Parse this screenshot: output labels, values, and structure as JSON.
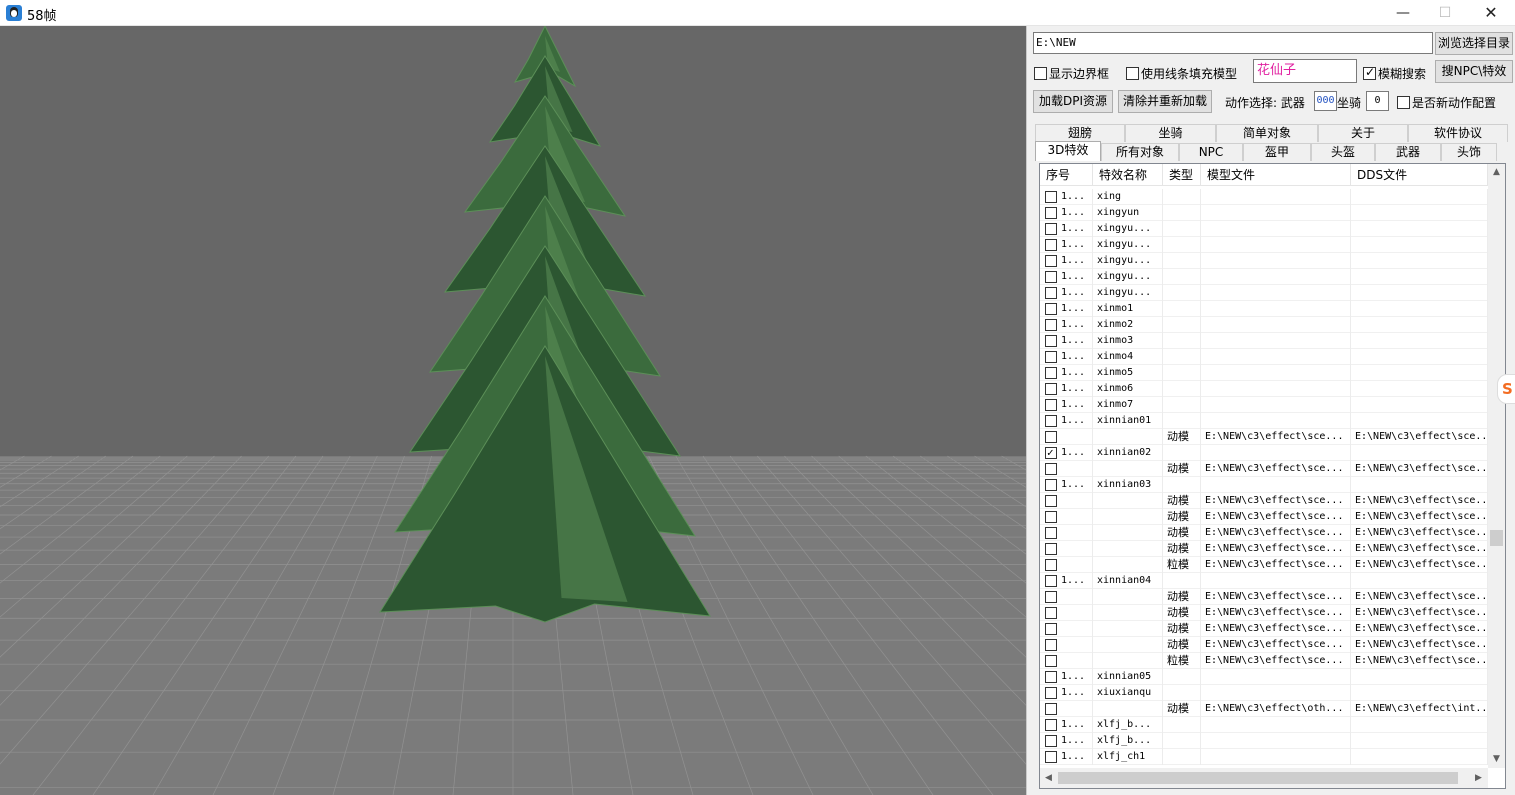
{
  "window": {
    "title": "58帧",
    "minimize_glyph": "—",
    "maximize_glyph": "☐",
    "close_glyph": "✕",
    "icon": "penguin-icon"
  },
  "toolbar": {
    "path_value": "E:\\NEW",
    "browse_label": "浏览选择目录",
    "show_border_label": "显示边界框",
    "show_border_checked": false,
    "line_fill_label": "使用线条填充模型",
    "line_fill_checked": false,
    "search_value": "花仙子",
    "search_color": "#e020a0",
    "fuzzy_label": "模糊搜索",
    "fuzzy_checked": true,
    "search_npc_label": "搜NPC\\特效",
    "load_dpi_label": "加载DPI资源",
    "clear_reload_label": "清除并重新加载",
    "action_label": "动作选择: 武器",
    "weapon_value": "000",
    "mount_label": "坐骑",
    "mount_value": "0",
    "new_action_label": "是否新动作配置",
    "new_action_checked": false
  },
  "tabs": {
    "row1": [
      "翅膀",
      "坐骑",
      "简单对象",
      "关于",
      "软件协议"
    ],
    "row2": [
      "3D特效",
      "所有对象",
      "NPC",
      "盔甲",
      "头盔",
      "武器",
      "头饰"
    ],
    "active": "3D特效"
  },
  "list": {
    "columns": [
      "序号",
      "特效名称",
      "类型",
      "模型文件",
      "DDS文件"
    ],
    "rows": [
      {
        "idx": "1...",
        "name": "xing",
        "type": "",
        "model": "",
        "dds": "",
        "checked": false
      },
      {
        "idx": "1...",
        "name": "xingyun",
        "type": "",
        "model": "",
        "dds": "",
        "checked": false
      },
      {
        "idx": "1...",
        "name": "xingyu...",
        "type": "",
        "model": "",
        "dds": "",
        "checked": false
      },
      {
        "idx": "1...",
        "name": "xingyu...",
        "type": "",
        "model": "",
        "dds": "",
        "checked": false
      },
      {
        "idx": "1...",
        "name": "xingyu...",
        "type": "",
        "model": "",
        "dds": "",
        "checked": false
      },
      {
        "idx": "1...",
        "name": "xingyu...",
        "type": "",
        "model": "",
        "dds": "",
        "checked": false
      },
      {
        "idx": "1...",
        "name": "xingyu...",
        "type": "",
        "model": "",
        "dds": "",
        "checked": false
      },
      {
        "idx": "1...",
        "name": "xinmo1",
        "type": "",
        "model": "",
        "dds": "",
        "checked": false
      },
      {
        "idx": "1...",
        "name": "xinmo2",
        "type": "",
        "model": "",
        "dds": "",
        "checked": false
      },
      {
        "idx": "1...",
        "name": "xinmo3",
        "type": "",
        "model": "",
        "dds": "",
        "checked": false
      },
      {
        "idx": "1...",
        "name": "xinmo4",
        "type": "",
        "model": "",
        "dds": "",
        "checked": false
      },
      {
        "idx": "1...",
        "name": "xinmo5",
        "type": "",
        "model": "",
        "dds": "",
        "checked": false
      },
      {
        "idx": "1...",
        "name": "xinmo6",
        "type": "",
        "model": "",
        "dds": "",
        "checked": false
      },
      {
        "idx": "1...",
        "name": "xinmo7",
        "type": "",
        "model": "",
        "dds": "",
        "checked": false
      },
      {
        "idx": "1...",
        "name": "xinnian01",
        "type": "",
        "model": "",
        "dds": "",
        "checked": false
      },
      {
        "idx": "",
        "name": "",
        "type": "动模",
        "model": "E:\\NEW\\c3\\effect\\sce...",
        "dds": "E:\\NEW\\c3\\effect\\sce...",
        "checked": false
      },
      {
        "idx": "1...",
        "name": "xinnian02",
        "type": "",
        "model": "",
        "dds": "",
        "checked": true
      },
      {
        "idx": "",
        "name": "",
        "type": "动模",
        "model": "E:\\NEW\\c3\\effect\\sce...",
        "dds": "E:\\NEW\\c3\\effect\\sce...",
        "checked": false
      },
      {
        "idx": "1...",
        "name": "xinnian03",
        "type": "",
        "model": "",
        "dds": "",
        "checked": false
      },
      {
        "idx": "",
        "name": "",
        "type": "动模",
        "model": "E:\\NEW\\c3\\effect\\sce...",
        "dds": "E:\\NEW\\c3\\effect\\sce...",
        "checked": false
      },
      {
        "idx": "",
        "name": "",
        "type": "动模",
        "model": "E:\\NEW\\c3\\effect\\sce...",
        "dds": "E:\\NEW\\c3\\effect\\sce...",
        "checked": false
      },
      {
        "idx": "",
        "name": "",
        "type": "动模",
        "model": "E:\\NEW\\c3\\effect\\sce...",
        "dds": "E:\\NEW\\c3\\effect\\sce...",
        "checked": false
      },
      {
        "idx": "",
        "name": "",
        "type": "动模",
        "model": "E:\\NEW\\c3\\effect\\sce...",
        "dds": "E:\\NEW\\c3\\effect\\sce...",
        "checked": false
      },
      {
        "idx": "",
        "name": "",
        "type": "粒模",
        "model": "E:\\NEW\\c3\\effect\\sce...",
        "dds": "E:\\NEW\\c3\\effect\\sce...",
        "checked": false
      },
      {
        "idx": "1...",
        "name": "xinnian04",
        "type": "",
        "model": "",
        "dds": "",
        "checked": false
      },
      {
        "idx": "",
        "name": "",
        "type": "动模",
        "model": "E:\\NEW\\c3\\effect\\sce...",
        "dds": "E:\\NEW\\c3\\effect\\sce...",
        "checked": false
      },
      {
        "idx": "",
        "name": "",
        "type": "动模",
        "model": "E:\\NEW\\c3\\effect\\sce...",
        "dds": "E:\\NEW\\c3\\effect\\sce...",
        "checked": false
      },
      {
        "idx": "",
        "name": "",
        "type": "动模",
        "model": "E:\\NEW\\c3\\effect\\sce...",
        "dds": "E:\\NEW\\c3\\effect\\sce...",
        "checked": false
      },
      {
        "idx": "",
        "name": "",
        "type": "动模",
        "model": "E:\\NEW\\c3\\effect\\sce...",
        "dds": "E:\\NEW\\c3\\effect\\sce...",
        "checked": false
      },
      {
        "idx": "",
        "name": "",
        "type": "粒模",
        "model": "E:\\NEW\\c3\\effect\\sce...",
        "dds": "E:\\NEW\\c3\\effect\\sce...",
        "checked": false
      },
      {
        "idx": "1...",
        "name": "xinnian05",
        "type": "",
        "model": "",
        "dds": "",
        "checked": false
      },
      {
        "idx": "1...",
        "name": "xiuxianqu",
        "type": "",
        "model": "",
        "dds": "",
        "checked": false
      },
      {
        "idx": "",
        "name": "",
        "type": "动模",
        "model": "E:\\NEW\\c3\\effect\\oth...",
        "dds": "E:\\NEW\\c3\\effect\\int...",
        "checked": false
      },
      {
        "idx": "1...",
        "name": "xlfj_b...",
        "type": "",
        "model": "",
        "dds": "",
        "checked": false
      },
      {
        "idx": "1...",
        "name": "xlfj_b...",
        "type": "",
        "model": "",
        "dds": "",
        "checked": false
      },
      {
        "idx": "1...",
        "name": "xlfj_ch1",
        "type": "",
        "model": "",
        "dds": "",
        "checked": false
      }
    ]
  },
  "scrollbars": {
    "up": "▲",
    "down": "▼",
    "left": "◀",
    "right": "▶"
  },
  "side_badge": {
    "glyph": "S",
    "color": "#f36c21"
  },
  "colors": {
    "viewport_sky": "#676767",
    "viewport_floor": "#7b7b7b",
    "grid_line": "#9a9a9a",
    "foliage_dark": "#2c5631",
    "foliage_light": "#5c8f58",
    "trunk": "#7a4a35"
  }
}
